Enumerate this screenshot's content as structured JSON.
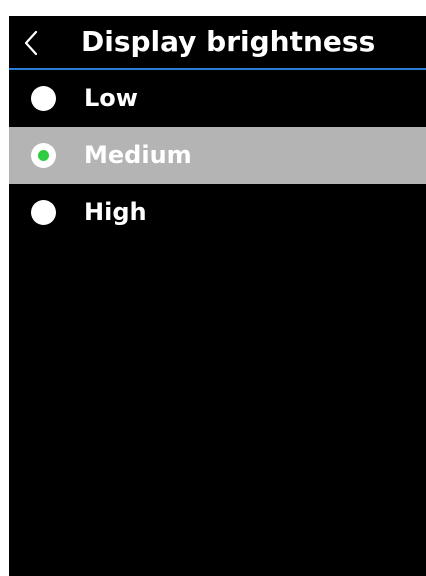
{
  "header": {
    "title": "Display brightness",
    "back_icon": "chevron-left-icon"
  },
  "options": [
    {
      "label": "Low",
      "selected": false
    },
    {
      "label": "Medium",
      "selected": true
    },
    {
      "label": "High",
      "selected": false
    }
  ],
  "colors": {
    "background": "#000000",
    "header_divider": "#2a7fd4",
    "selected_row": "#b4b4b4",
    "radio": "#ffffff",
    "radio_selected_dot": "#2ecc40"
  }
}
